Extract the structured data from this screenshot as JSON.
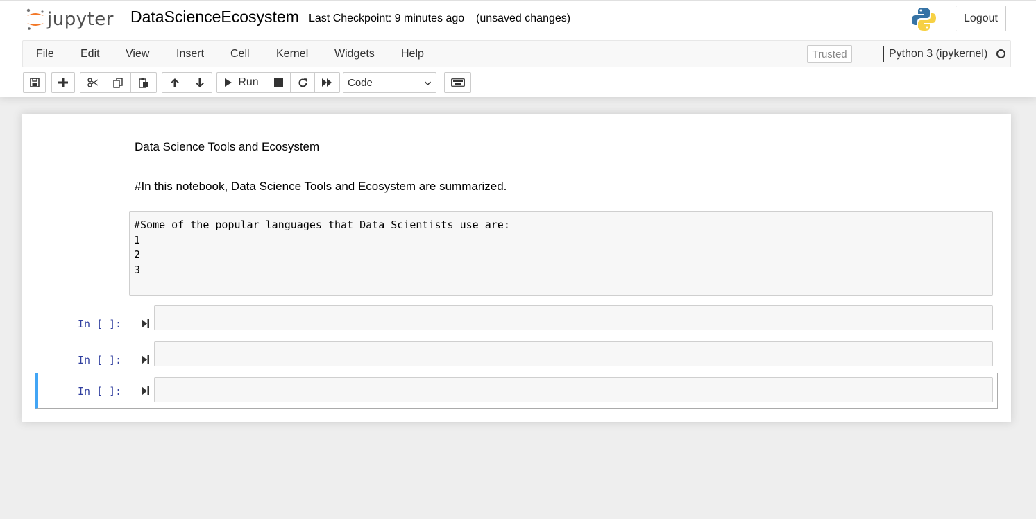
{
  "header": {
    "logo_text": "jupyter",
    "notebook_title": "DataScienceEcosystem",
    "checkpoint": "Last Checkpoint: 9 minutes ago",
    "autosave_status": "(unsaved changes)",
    "logout_label": "Logout"
  },
  "menubar": {
    "items": [
      "File",
      "Edit",
      "View",
      "Insert",
      "Cell",
      "Kernel",
      "Widgets",
      "Help"
    ],
    "trusted_label": "Trusted",
    "kernel_name": "Python 3 (ipykernel)"
  },
  "toolbar": {
    "run_label": "Run",
    "cell_type": "Code"
  },
  "cells": {
    "markdown_1": "Data Science Tools and Ecosystem",
    "markdown_2": "#In this notebook, Data Science Tools and Ecosystem are summarized.",
    "raw_cell": "#Some of the popular languages that Data Scientists use are:\n1\n2\n3",
    "code_prompts": [
      "In [ ]:",
      "In [ ]:",
      "In [ ]:"
    ]
  },
  "colors": {
    "accent_selected": "#42a5f5",
    "prompt_color": "#303f9f",
    "jupyter_orange": "#f37726"
  }
}
